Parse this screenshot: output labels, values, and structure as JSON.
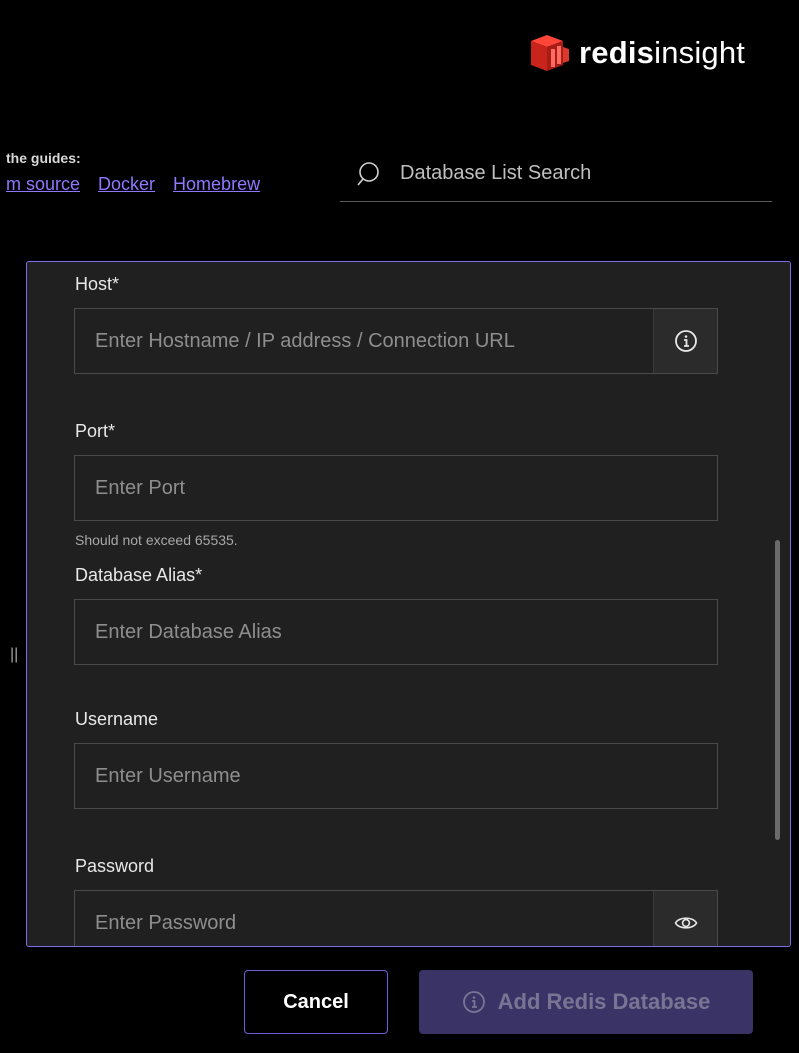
{
  "brand": {
    "name_bold": "redis",
    "name_regular": "insight",
    "color": "#dc382c"
  },
  "guides": {
    "title": "the guides:",
    "links": [
      "m source",
      "Docker",
      "Homebrew"
    ]
  },
  "search": {
    "placeholder": "Database List Search",
    "icon": "search-icon"
  },
  "form": {
    "host": {
      "label": "Host*",
      "placeholder": "Enter Hostname / IP address / Connection URL",
      "addon_icon": "info-icon"
    },
    "port": {
      "label": "Port*",
      "placeholder": "Enter Port",
      "helper": "Should not exceed 65535."
    },
    "alias": {
      "label": "Database Alias*",
      "placeholder": "Enter Database Alias"
    },
    "username": {
      "label": "Username",
      "placeholder": "Enter Username"
    },
    "password": {
      "label": "Password",
      "placeholder": "Enter Password",
      "addon_icon": "eye-icon"
    }
  },
  "resize_handle": "||",
  "actions": {
    "cancel_label": "Cancel",
    "add_label": "Add Redis Database",
    "add_icon": "info-icon"
  },
  "colors": {
    "accent": "#7c6ee6",
    "link": "#8f77ff",
    "panel_bg": "#202020",
    "disabled_button": "#3a3365"
  }
}
